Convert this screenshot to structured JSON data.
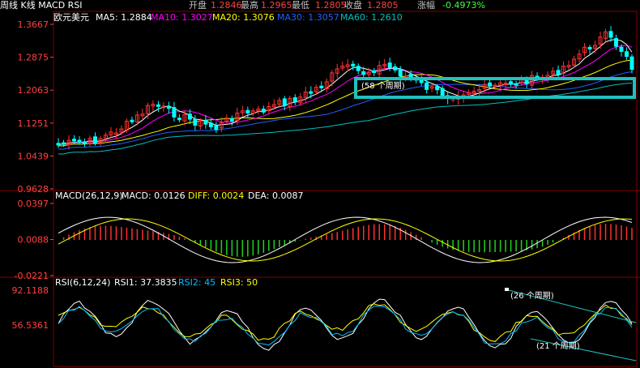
{
  "header": {
    "mode": "周线 K线 MACD RSI",
    "open_label": "开盘",
    "open_value": "1.2846",
    "high_label": "最高",
    "high_value": "1.2965",
    "low_label": "最低",
    "low_value": "1.2805",
    "close_label": "收盘",
    "close_value": "1.2805",
    "chg_label": "涨幅",
    "chg_value": "-0.4973%"
  },
  "main_legend": {
    "symbol": "欧元美元",
    "ma5": "MA5: 1.2884",
    "ma10": "MA10: 1.3027",
    "ma20": "MA20: 1.3076",
    "ma30": "MA30: 1.3057",
    "ma60": "MA60: 1.2610"
  },
  "macd_legend": {
    "name": "MACD(26,12,9)",
    "macd": "MACD: 0.0126",
    "diff": "DIFF: 0.0024",
    "dea": "DEA: 0.0087"
  },
  "rsi_legend": {
    "name": "RSI(6,12,24)",
    "rsi1": "RSI1: 37.3835",
    "rsi2": "RSI2: 45",
    "rsi3": "RSI3: 50"
  },
  "annotations": {
    "box_label": "(58 个周期)",
    "rsi_top": "(26 个周期)",
    "rsi_bottom": "(21 个周期)"
  },
  "colors": {
    "up": "#ff3030",
    "down": "#00ffff",
    "ma5": "#ffffff",
    "ma10": "#ff00ff",
    "ma20": "#ffff00",
    "ma30": "#2060ff",
    "ma60": "#00c0c0",
    "axis_text": "#ff4040",
    "grid": "#800000",
    "box": "#20c0c0"
  },
  "chart_data": [
    {
      "type": "candlestick",
      "y_ticks": [
        "1.3667",
        "1.2875",
        "1.2063",
        "1.1251",
        "1.0439",
        "0.9628"
      ],
      "ylim": [
        0.9628,
        1.3667
      ],
      "series": [
        {
          "name": "MA5"
        },
        {
          "name": "MA10"
        },
        {
          "name": "MA20"
        },
        {
          "name": "MA30"
        },
        {
          "name": "MA60"
        }
      ]
    },
    {
      "type": "bar",
      "y_ticks": [
        "0.0397",
        "0.0088",
        "-0.0221"
      ],
      "ylim": [
        -0.0221,
        0.0397
      ],
      "series": [
        {
          "name": "DIFF"
        },
        {
          "name": "DEA"
        },
        {
          "name": "MACD"
        }
      ]
    },
    {
      "type": "line",
      "y_ticks": [
        "92.1188",
        "56.5361"
      ],
      "series": [
        {
          "name": "RSI1"
        },
        {
          "name": "RSI2"
        },
        {
          "name": "RSI3"
        }
      ]
    }
  ]
}
